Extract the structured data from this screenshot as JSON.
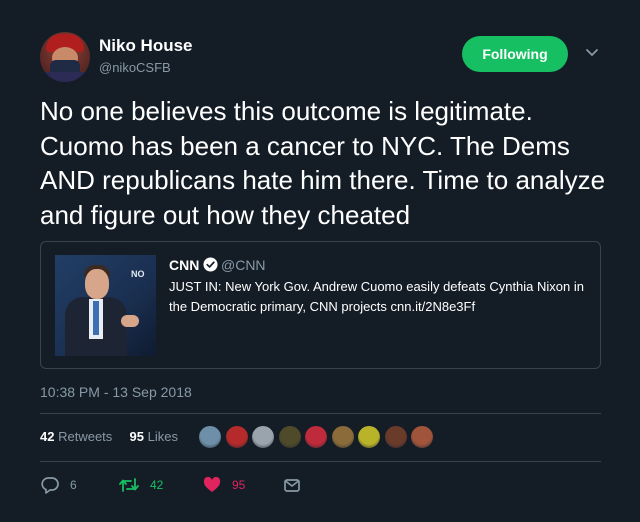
{
  "author": {
    "display_name": "Niko House",
    "handle": "@nikoCSFB"
  },
  "follow_button": {
    "label": "Following",
    "color": "#17bf63"
  },
  "tweet": {
    "text": "No one believes this outcome is legitimate. Cuomo has been a cancer to NYC. The Dems AND republicans hate him there. Time to analyze and figure out how they cheated"
  },
  "quoted": {
    "name": "CNN",
    "handle": "@CNN",
    "text": "JUST IN: New York Gov. Andrew Cuomo easily defeats Cynthia Nixon in the Democratic primary, CNN projects cnn.it/2N8e3Ff",
    "image_logo_text": "NO"
  },
  "timestamp": "10:38 PM - 13 Sep 2018",
  "stats": {
    "retweets_count": "42",
    "retweets_label": "Retweets",
    "likes_count": "95",
    "likes_label": "Likes"
  },
  "liker_avatar_colors": [
    "#6d8fa8",
    "#b52a2a",
    "#9aa4ad",
    "#4f4a2a",
    "#c02b3b",
    "#8b6b3a",
    "#b9b32a",
    "#6b3b2a",
    "#a0543a"
  ],
  "actions": {
    "reply_count": "6",
    "retweet_count": "42",
    "like_count": "95"
  },
  "colors": {
    "background": "#141d26",
    "muted": "#8899a6",
    "retweet_green": "#17bf63",
    "like_red": "#e0245e"
  }
}
